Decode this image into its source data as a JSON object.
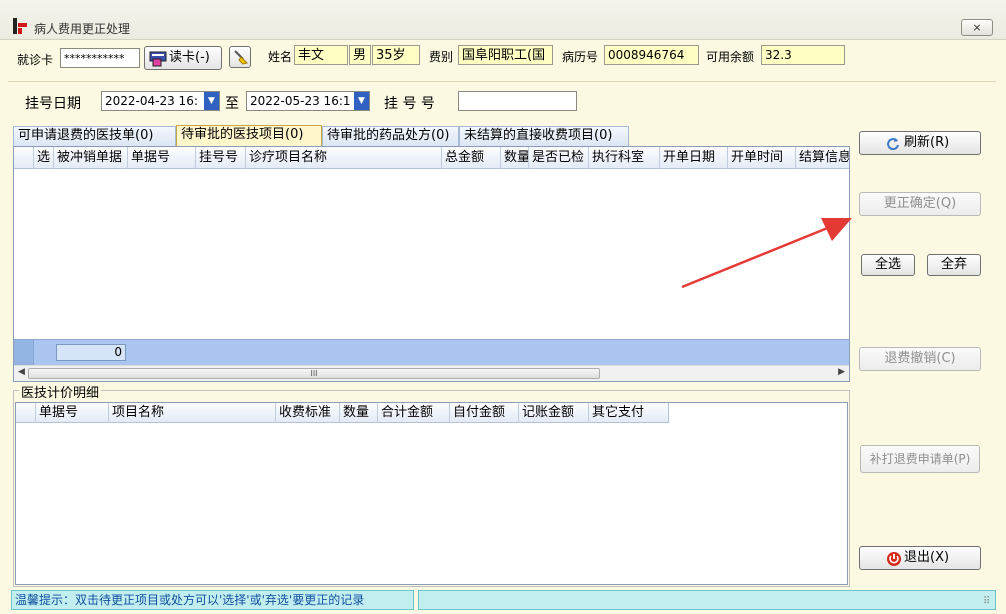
{
  "window": {
    "title": "病人费用更正处理",
    "close_label": "⨯"
  },
  "patient": {
    "card_label": "就诊卡",
    "card_value": "***********",
    "read_card_label": "读卡(-)",
    "name_label": "姓名",
    "name_value": "丰文",
    "gender_value": "男",
    "age_value": "35岁",
    "fee_type_label": "费别",
    "fee_type_value": "国阜阳职工(国",
    "record_no_label": "病历号",
    "record_no_value": "0008946764",
    "balance_label": "可用余额",
    "balance_value": "32.3"
  },
  "register": {
    "date_label": "挂号日期",
    "date_from": "2022-04-23 16:",
    "to_label": "至",
    "date_to": "2022-05-23 16:1",
    "reg_no_label": "挂 号 号",
    "reg_no_value": ""
  },
  "tabs": [
    {
      "label": "可申请退费的医技单(0)"
    },
    {
      "label": "待审批的医技项目(0)"
    },
    {
      "label": "待审批的药品处方(0)"
    },
    {
      "label": "未结算的直接收费项目(0)"
    }
  ],
  "grid1": {
    "columns": [
      "选",
      "被冲销单据",
      "单据号",
      "挂号号",
      "诊疗项目名称",
      "总金额",
      "数量",
      "是否已检",
      "执行科室",
      "开单日期",
      "开单时间",
      "结算信息"
    ],
    "footer_count": "0"
  },
  "detail": {
    "group_title": "医技计价明细",
    "columns": [
      "单据号",
      "项目名称",
      "收费标准",
      "数量",
      "合计金额",
      "自付金额",
      "记账金额",
      "其它支付"
    ]
  },
  "actions": {
    "refresh": "刷新(R)",
    "confirm": "更正确定(Q)",
    "select_all": "全选",
    "discard_all": "全弃",
    "cancel_refund": "退费撤销(C)",
    "reprint": "补打退费申请单(P)",
    "exit": "退出(X)"
  },
  "status": {
    "hint": "温馨提示：双击待更正项目或处方可以'选择'或'弃选'要更正的记录"
  },
  "colors": {
    "field_yellow": "#ffffc4",
    "arrow": "#e53935",
    "footer_blue": "#aac6f0"
  }
}
